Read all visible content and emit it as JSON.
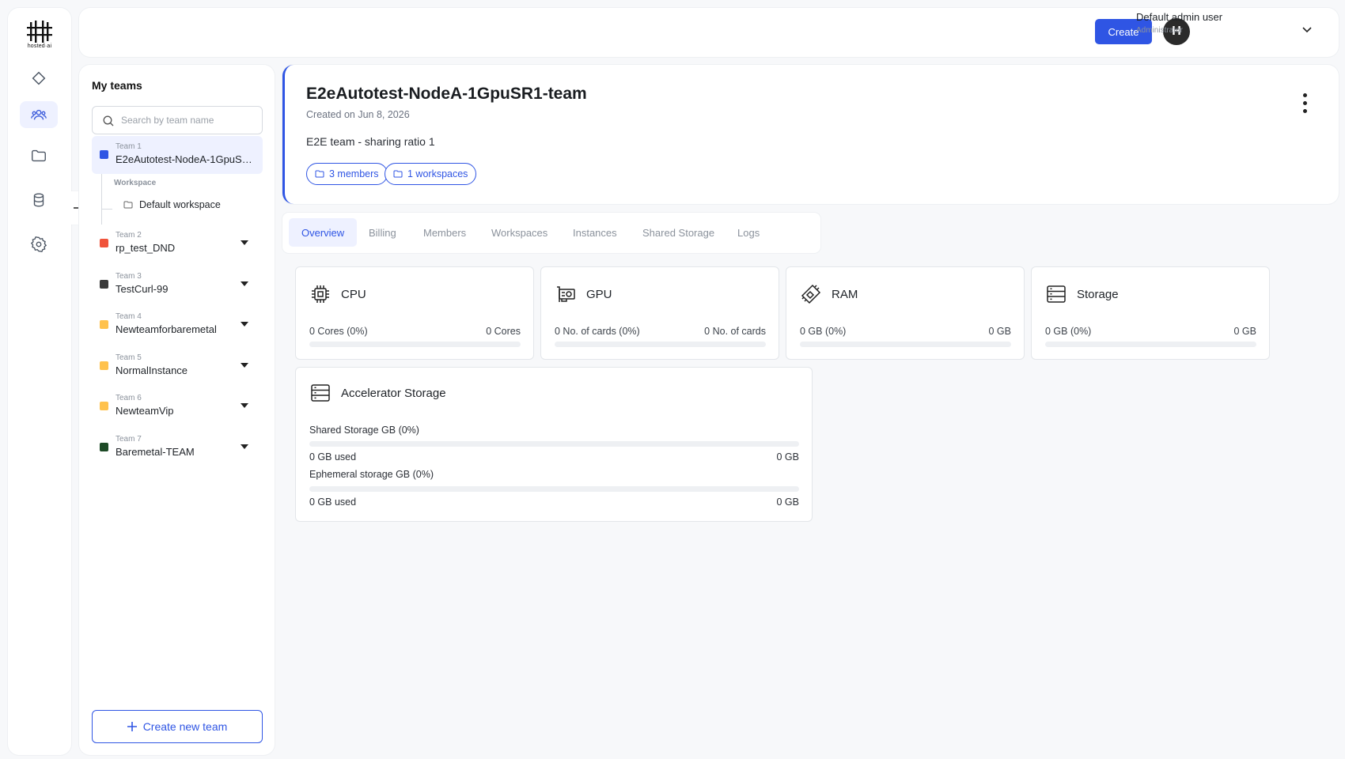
{
  "brand": {
    "logo_text": "hosted·ai"
  },
  "header": {
    "create_label": "Create",
    "avatar_initial": "H",
    "user_name": "Default admin user",
    "user_role": "Administrator"
  },
  "teams_panel": {
    "title": "My teams",
    "search_placeholder": "Search by team name",
    "workspace_label": "Workspace",
    "workspace_name": "Default workspace",
    "create_team_label": "Create new team",
    "teams": [
      {
        "num": "Team 1",
        "name": "E2eAutotest-NodeA-1GpuSR1-team",
        "color": "#2f55e4"
      },
      {
        "num": "Team 2",
        "name": "rp_test_DND",
        "color": "#f0533b"
      },
      {
        "num": "Team 3",
        "name": "TestCurl-99",
        "color": "#3a3a3a"
      },
      {
        "num": "Team 4",
        "name": "Newteamforbaremetal",
        "color": "#ffc24d"
      },
      {
        "num": "Team 5",
        "name": "NormalInstance",
        "color": "#ffc24d"
      },
      {
        "num": "Team 6",
        "name": "NewteamVip",
        "color": "#ffc24d"
      },
      {
        "num": "Team 7",
        "name": "Baremetal-TEAM",
        "color": "#1d4a26"
      }
    ]
  },
  "team_detail": {
    "title": "E2eAutotest-NodeA-1GpuSR1-team",
    "created": "Created on Jun 8, 2026",
    "description": "E2E team - sharing ratio 1",
    "members_pill": "3 members",
    "workspaces_pill": "1 workspaces"
  },
  "tabs": [
    "Overview",
    "Billing",
    "Members",
    "Workspaces",
    "Instances",
    "Shared Storage",
    "Logs"
  ],
  "resources": [
    {
      "title": "CPU",
      "used": "0 Cores (0%)",
      "total": "0 Cores",
      "percent": 0,
      "icon": "cpu-icon"
    },
    {
      "title": "GPU",
      "used": "0 No. of cards (0%)",
      "total": "0 No. of cards",
      "percent": 0,
      "icon": "gpu-icon"
    },
    {
      "title": "RAM",
      "used": "0 GB (0%)",
      "total": "0 GB",
      "percent": 0,
      "icon": "ram-icon"
    },
    {
      "title": "Storage",
      "used": "0 GB (0%)",
      "total": "0 GB",
      "percent": 0,
      "icon": "storage-icon"
    }
  ],
  "accelerator_storage": {
    "title": "Accelerator Storage",
    "shared_label": "Shared Storage GB (0%)",
    "shared_used": "0 GB used",
    "shared_total": "0 GB",
    "shared_percent": 0,
    "ephemeral_label": "Ephemeral storage GB (0%)",
    "ephemeral_used": "0 GB used",
    "ephemeral_total": "0 GB",
    "ephemeral_percent": 0
  },
  "colors": {
    "accent": "#2f55e4",
    "active_bg": "#eef1ff"
  }
}
